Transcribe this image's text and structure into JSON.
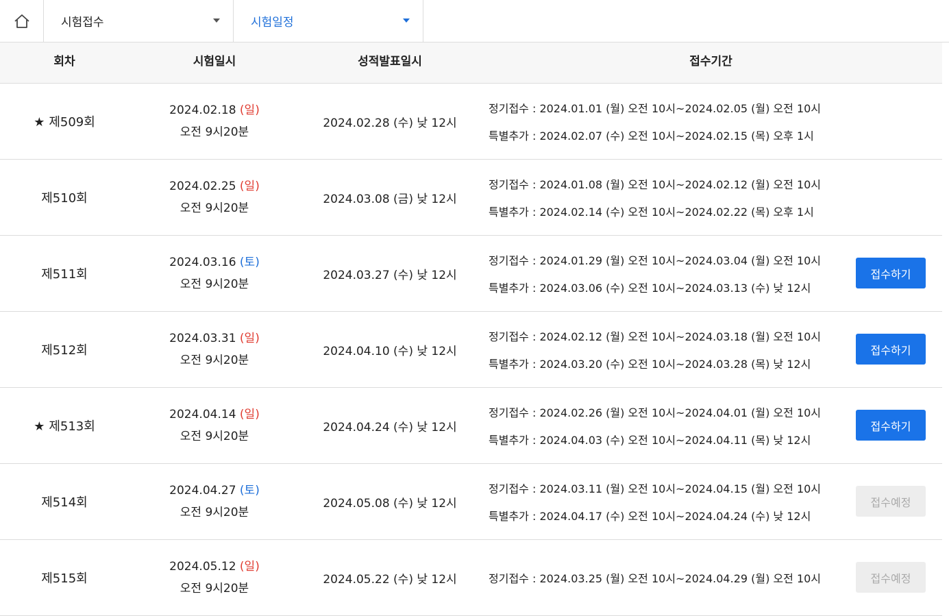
{
  "nav": {
    "dropdown1": "시험접수",
    "dropdown2": "시험일정"
  },
  "table": {
    "headers": [
      "회차",
      "시험일시",
      "성적발표일시",
      "접수기간"
    ],
    "rows": [
      {
        "star": "★",
        "round": "제509회",
        "date": "2024.02.18",
        "day": "(일)",
        "time": "오전 9시20분",
        "result": "2024.02.28 (수) 낮 12시",
        "regular": "정기접수 : 2024.01.01 (월) 오전 10시~2024.02.05 (월) 오전 10시",
        "special": "특별추가 : 2024.02.07 (수) 오전 10시~2024.02.15 (목) 오후 1시",
        "button": ""
      },
      {
        "star": "",
        "round": "제510회",
        "date": "2024.02.25",
        "day": "(일)",
        "time": "오전 9시20분",
        "result": "2024.03.08 (금) 낮 12시",
        "regular": "정기접수 : 2024.01.08 (월) 오전 10시~2024.02.12 (월) 오전 10시",
        "special": "특별추가 : 2024.02.14 (수) 오전 10시~2024.02.22 (목) 오후 1시",
        "button": ""
      },
      {
        "star": "",
        "round": "제511회",
        "date": "2024.03.16",
        "day": "(토)",
        "time": "오전 9시20분",
        "result": "2024.03.27 (수) 낮 12시",
        "regular": "정기접수 : 2024.01.29 (월) 오전 10시~2024.03.04 (월) 오전 10시",
        "special": "특별추가 : 2024.03.06 (수) 오전 10시~2024.03.13 (수) 낮 12시",
        "button": "접수하기"
      },
      {
        "star": "",
        "round": "제512회",
        "date": "2024.03.31",
        "day": "(일)",
        "time": "오전 9시20분",
        "result": "2024.04.10 (수) 낮 12시",
        "regular": "정기접수 : 2024.02.12 (월) 오전 10시~2024.03.18 (월) 오전 10시",
        "special": "특별추가 : 2024.03.20 (수) 오전 10시~2024.03.28 (목) 낮 12시",
        "button": "접수하기"
      },
      {
        "star": "★",
        "round": "제513회",
        "date": "2024.04.14",
        "day": "(일)",
        "time": "오전 9시20분",
        "result": "2024.04.24 (수) 낮 12시",
        "regular": "정기접수 : 2024.02.26 (월) 오전 10시~2024.04.01 (월) 오전 10시",
        "special": "특별추가 : 2024.04.03 (수) 오전 10시~2024.04.11 (목) 낮 12시",
        "button": "접수하기"
      },
      {
        "star": "",
        "round": "제514회",
        "date": "2024.04.27",
        "day": "(토)",
        "time": "오전 9시20분",
        "result": "2024.05.08 (수) 낮 12시",
        "regular": "정기접수 : 2024.03.11 (월) 오전 10시~2024.04.15 (월) 오전 10시",
        "special": "특별추가 : 2024.04.17 (수) 오전 10시~2024.04.24 (수) 낮 12시",
        "button": "접수예정"
      },
      {
        "star": "",
        "round": "제515회",
        "date": "2024.05.12",
        "day": "(일)",
        "time": "오전 9시20분",
        "result": "2024.05.22 (수) 낮 12시",
        "regular": "정기접수 : 2024.03.25 (월) 오전 10시~2024.04.29 (월) 오전 10시",
        "special": "",
        "button": "접수예정"
      }
    ]
  }
}
